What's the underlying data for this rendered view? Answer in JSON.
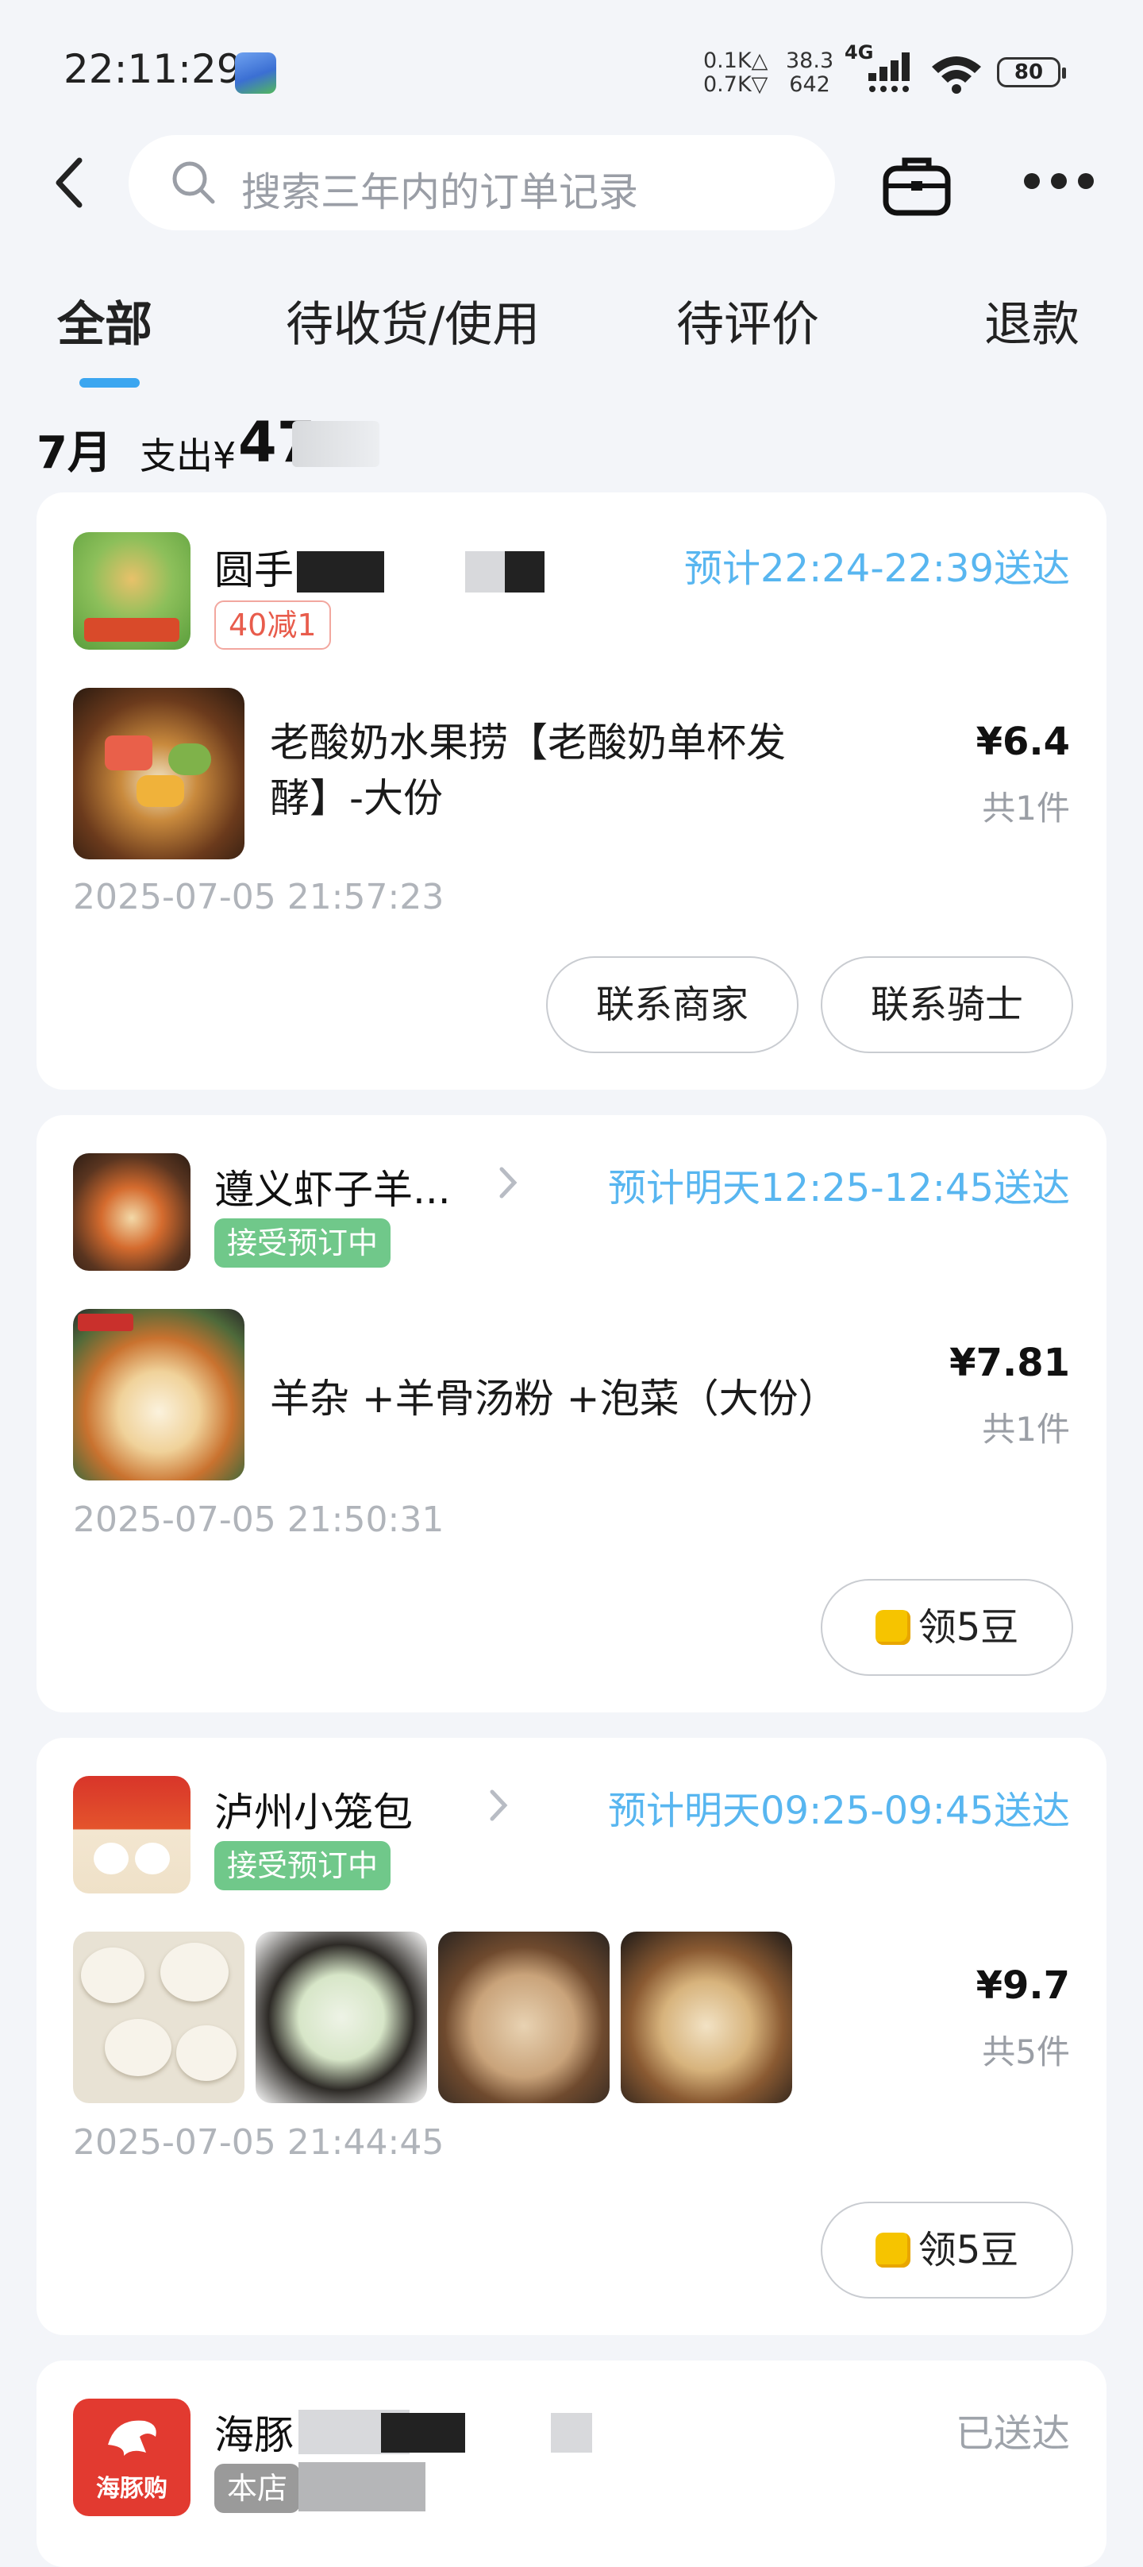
{
  "status_bar": {
    "time": "22:11:29",
    "net_up": "0.1K△",
    "net_down": "0.7K▽",
    "net_a": "38.3",
    "net_b": "642",
    "network": "4G",
    "battery": "80"
  },
  "search": {
    "placeholder": "搜索三年内的订单记录"
  },
  "tabs": [
    {
      "label": "全部",
      "active": true
    },
    {
      "label": "待收货/使用",
      "active": false
    },
    {
      "label": "待评价",
      "active": false
    },
    {
      "label": "退款",
      "active": false
    }
  ],
  "summary": {
    "month": "7月",
    "spend_label": "支出¥",
    "spend_amount": "47"
  },
  "orders": [
    {
      "shop_name": "圆手",
      "tag": "40减1",
      "eta": "预计22:24-22:39送达",
      "item_title_1": "老酸奶水果捞【老酸奶单杯发",
      "item_title_2": "酵】-大份",
      "price": "¥6.4",
      "count": "共1件",
      "timestamp": "2025-07-05 21:57:23",
      "buttons": [
        "联系商家",
        "联系骑士"
      ]
    },
    {
      "shop_name": "遵义虾子羊...",
      "tag": "接受预订中",
      "eta": "预计明天12:25-12:45送达",
      "item_title_1": "羊杂 +羊骨汤粉 +泡菜（大份）",
      "price": "¥7.81",
      "count": "共1件",
      "timestamp": "2025-07-05 21:50:31",
      "bean_button": "领5豆"
    },
    {
      "shop_name": "泸州小笼包",
      "tag": "接受预订中",
      "eta": "预计明天09:25-09:45送达",
      "price": "¥9.7",
      "count": "共5件",
      "timestamp": "2025-07-05 21:44:45",
      "bean_button": "领5豆"
    },
    {
      "shop_name": "海豚",
      "tag": "本店",
      "eta": "已送达",
      "logo_text": "海豚购"
    }
  ]
}
